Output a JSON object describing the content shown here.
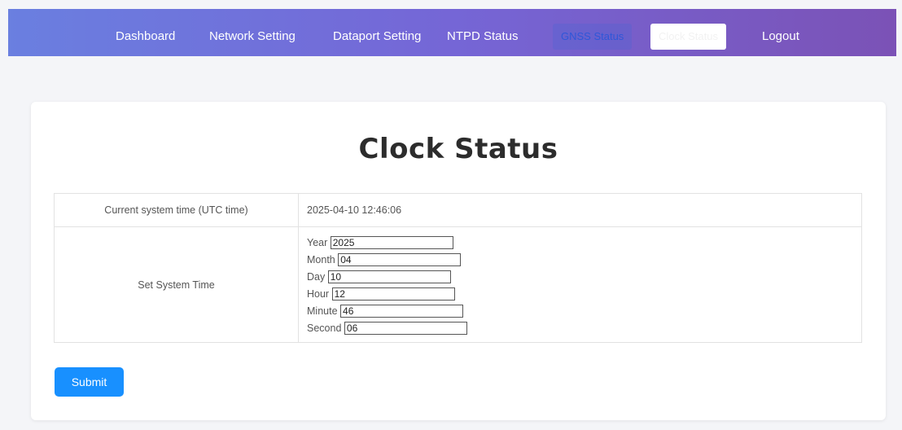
{
  "nav": {
    "items": [
      {
        "label": "Dashboard"
      },
      {
        "label": "Network Setting"
      },
      {
        "label": "Dataport Setting"
      },
      {
        "label": "NTPD Status"
      },
      {
        "label": "GNSS Status"
      },
      {
        "label": "Clock Status"
      },
      {
        "label": "Logout"
      }
    ]
  },
  "page": {
    "title": "Clock Status"
  },
  "table": {
    "current_time_label": "Current system time (UTC time)",
    "current_time_value": "2025-04-10 12:46:06",
    "set_time_label": "Set System Time",
    "fields": {
      "year": {
        "label": "Year",
        "value": "2025"
      },
      "month": {
        "label": "Month",
        "value": "04"
      },
      "day": {
        "label": "Day",
        "value": "10"
      },
      "hour": {
        "label": "Hour",
        "value": "12"
      },
      "minute": {
        "label": "Minute",
        "value": "46"
      },
      "second": {
        "label": "Second",
        "value": "06"
      }
    }
  },
  "submit_label": "Submit",
  "colors": {
    "nav_gradient_start": "#6a7fe0",
    "nav_gradient_end": "#7b52b6",
    "submit_button": "#1890ff",
    "gnss_text": "#2f57d8"
  }
}
